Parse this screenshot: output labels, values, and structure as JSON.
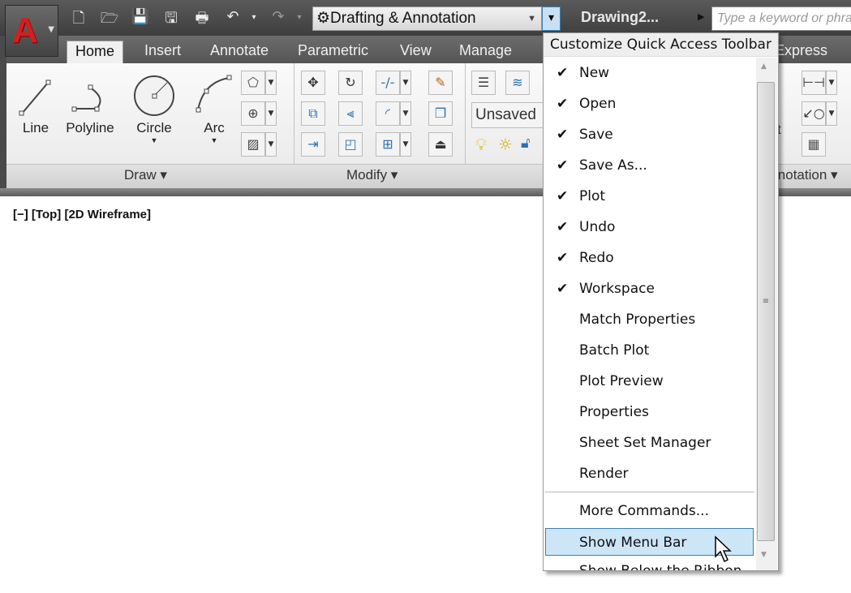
{
  "app": {
    "logo_letter": "A",
    "title": "Drawing2...",
    "search_placeholder": "Type a keyword or phrase"
  },
  "quick_access": {
    "icons": [
      "new-icon",
      "open-icon",
      "save-icon",
      "save-as-icon",
      "plot-icon",
      "undo-icon",
      "redo-icon"
    ],
    "workspace": "Drafting & Annotation"
  },
  "tabs": [
    "Home",
    "Insert",
    "Annotate",
    "Parametric",
    "View",
    "Manage",
    "Express Tools"
  ],
  "ribbon": {
    "draw": {
      "title": "Draw ▾",
      "tools": [
        "Line",
        "Polyline",
        "Circle",
        "Arc"
      ]
    },
    "modify": {
      "title": "Modify ▾"
    },
    "layers": {
      "current": "Unsaved Layer State"
    },
    "annotation": {
      "title": "Annotation ▾",
      "partial_text": "t"
    }
  },
  "viewport": {
    "label": "[−] [Top] [2D Wireframe]"
  },
  "menu": {
    "title": "Customize Quick Access Toolbar",
    "items": [
      {
        "label": "New",
        "checked": true
      },
      {
        "label": "Open",
        "checked": true
      },
      {
        "label": "Save",
        "checked": true
      },
      {
        "label": "Save As...",
        "checked": true
      },
      {
        "label": "Plot",
        "checked": true
      },
      {
        "label": "Undo",
        "checked": true
      },
      {
        "label": "Redo",
        "checked": true
      },
      {
        "label": "Workspace",
        "checked": true
      },
      {
        "label": "Match Properties",
        "checked": false
      },
      {
        "label": "Batch Plot",
        "checked": false
      },
      {
        "label": "Plot Preview",
        "checked": false
      },
      {
        "label": "Properties",
        "checked": false
      },
      {
        "label": "Sheet Set Manager",
        "checked": false
      },
      {
        "label": "Render",
        "checked": false
      }
    ],
    "more": "More Commands...",
    "show_menu_bar": "Show Menu Bar",
    "show_below": "Show Below the Ribbon",
    "check": "✔"
  },
  "colors": {
    "highlight": "#cde6f7",
    "highlight_border": "#3c7fb1",
    "logo_red": "#d21f1f"
  }
}
